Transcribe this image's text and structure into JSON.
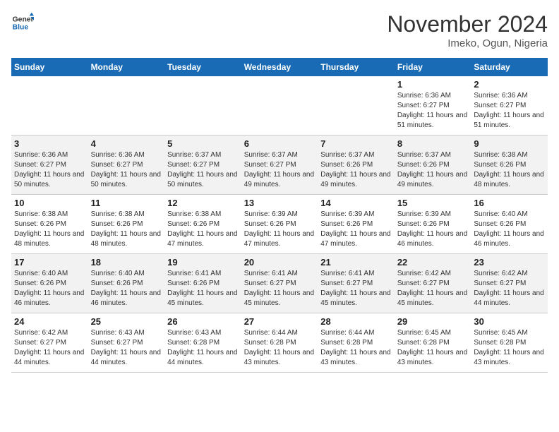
{
  "header": {
    "logo_line1": "General",
    "logo_line2": "Blue",
    "month_title": "November 2024",
    "location": "Imeko, Ogun, Nigeria"
  },
  "weekdays": [
    "Sunday",
    "Monday",
    "Tuesday",
    "Wednesday",
    "Thursday",
    "Friday",
    "Saturday"
  ],
  "weeks": [
    [
      {
        "day": "",
        "info": ""
      },
      {
        "day": "",
        "info": ""
      },
      {
        "day": "",
        "info": ""
      },
      {
        "day": "",
        "info": ""
      },
      {
        "day": "",
        "info": ""
      },
      {
        "day": "1",
        "info": "Sunrise: 6:36 AM\nSunset: 6:27 PM\nDaylight: 11 hours and 51 minutes."
      },
      {
        "day": "2",
        "info": "Sunrise: 6:36 AM\nSunset: 6:27 PM\nDaylight: 11 hours and 51 minutes."
      }
    ],
    [
      {
        "day": "3",
        "info": "Sunrise: 6:36 AM\nSunset: 6:27 PM\nDaylight: 11 hours and 50 minutes."
      },
      {
        "day": "4",
        "info": "Sunrise: 6:36 AM\nSunset: 6:27 PM\nDaylight: 11 hours and 50 minutes."
      },
      {
        "day": "5",
        "info": "Sunrise: 6:37 AM\nSunset: 6:27 PM\nDaylight: 11 hours and 50 minutes."
      },
      {
        "day": "6",
        "info": "Sunrise: 6:37 AM\nSunset: 6:27 PM\nDaylight: 11 hours and 49 minutes."
      },
      {
        "day": "7",
        "info": "Sunrise: 6:37 AM\nSunset: 6:26 PM\nDaylight: 11 hours and 49 minutes."
      },
      {
        "day": "8",
        "info": "Sunrise: 6:37 AM\nSunset: 6:26 PM\nDaylight: 11 hours and 49 minutes."
      },
      {
        "day": "9",
        "info": "Sunrise: 6:38 AM\nSunset: 6:26 PM\nDaylight: 11 hours and 48 minutes."
      }
    ],
    [
      {
        "day": "10",
        "info": "Sunrise: 6:38 AM\nSunset: 6:26 PM\nDaylight: 11 hours and 48 minutes."
      },
      {
        "day": "11",
        "info": "Sunrise: 6:38 AM\nSunset: 6:26 PM\nDaylight: 11 hours and 48 minutes."
      },
      {
        "day": "12",
        "info": "Sunrise: 6:38 AM\nSunset: 6:26 PM\nDaylight: 11 hours and 47 minutes."
      },
      {
        "day": "13",
        "info": "Sunrise: 6:39 AM\nSunset: 6:26 PM\nDaylight: 11 hours and 47 minutes."
      },
      {
        "day": "14",
        "info": "Sunrise: 6:39 AM\nSunset: 6:26 PM\nDaylight: 11 hours and 47 minutes."
      },
      {
        "day": "15",
        "info": "Sunrise: 6:39 AM\nSunset: 6:26 PM\nDaylight: 11 hours and 46 minutes."
      },
      {
        "day": "16",
        "info": "Sunrise: 6:40 AM\nSunset: 6:26 PM\nDaylight: 11 hours and 46 minutes."
      }
    ],
    [
      {
        "day": "17",
        "info": "Sunrise: 6:40 AM\nSunset: 6:26 PM\nDaylight: 11 hours and 46 minutes."
      },
      {
        "day": "18",
        "info": "Sunrise: 6:40 AM\nSunset: 6:26 PM\nDaylight: 11 hours and 46 minutes."
      },
      {
        "day": "19",
        "info": "Sunrise: 6:41 AM\nSunset: 6:26 PM\nDaylight: 11 hours and 45 minutes."
      },
      {
        "day": "20",
        "info": "Sunrise: 6:41 AM\nSunset: 6:27 PM\nDaylight: 11 hours and 45 minutes."
      },
      {
        "day": "21",
        "info": "Sunrise: 6:41 AM\nSunset: 6:27 PM\nDaylight: 11 hours and 45 minutes."
      },
      {
        "day": "22",
        "info": "Sunrise: 6:42 AM\nSunset: 6:27 PM\nDaylight: 11 hours and 45 minutes."
      },
      {
        "day": "23",
        "info": "Sunrise: 6:42 AM\nSunset: 6:27 PM\nDaylight: 11 hours and 44 minutes."
      }
    ],
    [
      {
        "day": "24",
        "info": "Sunrise: 6:42 AM\nSunset: 6:27 PM\nDaylight: 11 hours and 44 minutes."
      },
      {
        "day": "25",
        "info": "Sunrise: 6:43 AM\nSunset: 6:27 PM\nDaylight: 11 hours and 44 minutes."
      },
      {
        "day": "26",
        "info": "Sunrise: 6:43 AM\nSunset: 6:28 PM\nDaylight: 11 hours and 44 minutes."
      },
      {
        "day": "27",
        "info": "Sunrise: 6:44 AM\nSunset: 6:28 PM\nDaylight: 11 hours and 43 minutes."
      },
      {
        "day": "28",
        "info": "Sunrise: 6:44 AM\nSunset: 6:28 PM\nDaylight: 11 hours and 43 minutes."
      },
      {
        "day": "29",
        "info": "Sunrise: 6:45 AM\nSunset: 6:28 PM\nDaylight: 11 hours and 43 minutes."
      },
      {
        "day": "30",
        "info": "Sunrise: 6:45 AM\nSunset: 6:28 PM\nDaylight: 11 hours and 43 minutes."
      }
    ]
  ]
}
